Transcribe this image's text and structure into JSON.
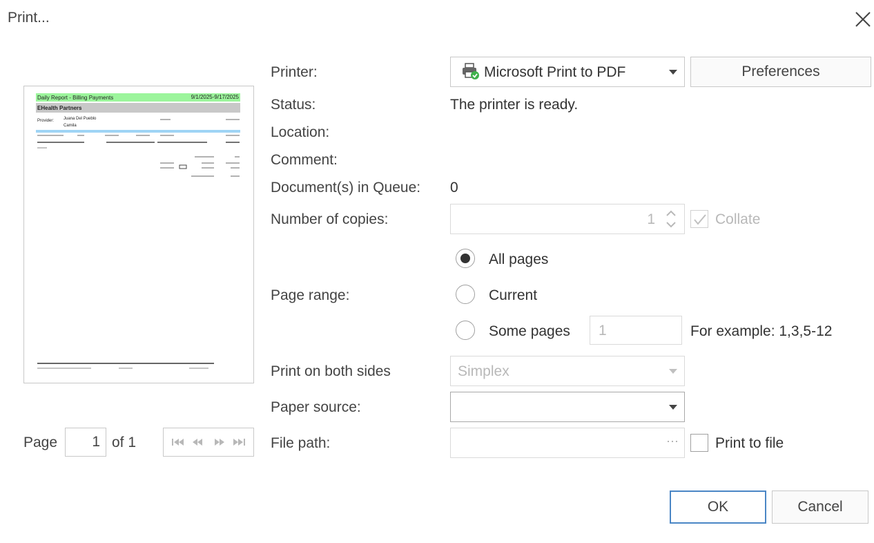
{
  "dialog": {
    "title": "Print..."
  },
  "preview": {
    "report_title": "Daily Report - Billing Payments",
    "date_range": "9/1/2025-9/17/2025",
    "org_name": "EHealth Partners",
    "provider_label": "Provider:",
    "provider_name": "Juana Del Pueblo",
    "provider_name2": "Camila"
  },
  "pager": {
    "page_label": "Page",
    "page_value": "1",
    "of_label": "of 1"
  },
  "printer": {
    "label": "Printer:",
    "selected": "Microsoft Print to PDF",
    "preferences_label": "Preferences"
  },
  "status": {
    "label": "Status:",
    "value": "The printer is ready."
  },
  "location": {
    "label": "Location:",
    "value": ""
  },
  "comment": {
    "label": "Comment:",
    "value": ""
  },
  "queue": {
    "label": "Document(s) in Queue:",
    "value": "0"
  },
  "copies": {
    "label": "Number of copies:",
    "value": "1",
    "collate_label": "Collate"
  },
  "page_range": {
    "label": "Page range:",
    "all_pages": "All pages",
    "current": "Current",
    "some_pages": "Some pages",
    "some_pages_value": "1",
    "example": "For example: 1,3,5-12"
  },
  "duplex": {
    "label": "Print on both sides",
    "value": "Simplex"
  },
  "paper_source": {
    "label": "Paper source:",
    "value": ""
  },
  "file_path": {
    "label": "File path:",
    "browse": "···",
    "print_to_file_label": "Print to file"
  },
  "buttons": {
    "ok": "OK",
    "cancel": "Cancel"
  },
  "colors": {
    "accent": "#4a86c5",
    "green_band": "#9cf59c",
    "blue_band": "#9fd4f5",
    "gray_band": "#c8c8c8"
  }
}
